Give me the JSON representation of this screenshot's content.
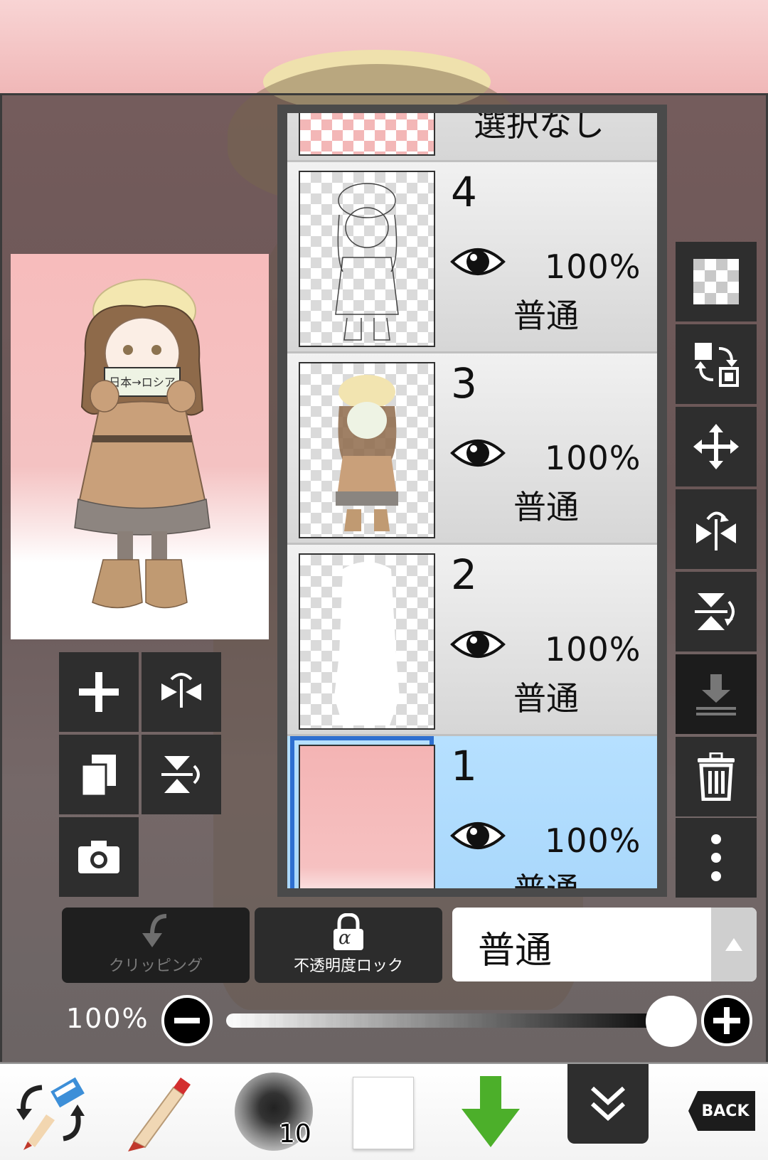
{
  "colors": {
    "panel_bg": "#2e2e2e",
    "selected_layer": "#a7d6fb",
    "selection_border": "#2e6fd0",
    "arrow_green": "#4caf2a"
  },
  "layer_panel": {
    "top_partial_label": "選択なし",
    "layers": [
      {
        "number": "4",
        "opacity": "100%",
        "blend": "普通",
        "visible": true,
        "selected": false
      },
      {
        "number": "3",
        "opacity": "100%",
        "blend": "普通",
        "visible": true,
        "selected": false
      },
      {
        "number": "2",
        "opacity": "100%",
        "blend": "普通",
        "visible": true,
        "selected": false
      },
      {
        "number": "1",
        "opacity": "100%",
        "blend": "普通",
        "visible": true,
        "selected": true
      }
    ]
  },
  "left_tools": [
    "add-layer-icon",
    "flip-horizontal-icon",
    "copy-layer-icon",
    "flip-vertical-icon",
    "camera-icon"
  ],
  "right_tools": [
    "transparent-fill-icon",
    "swap-layer-icon",
    "move-icon",
    "flip-horizontal-icon",
    "flip-vertical-icon",
    "merge-down-icon",
    "trash-icon",
    "more-vert-icon"
  ],
  "controls": {
    "clipping_label": "クリッピング",
    "opacity_lock_label": "不透明度ロック",
    "lock_symbol": "α",
    "blend_mode": "普通",
    "opacity_value": "100%",
    "opacity_fraction": 1.0
  },
  "toolbar": {
    "brush_size": "10",
    "back_label": "BACK",
    "preview_sign": "日本→ロシア"
  }
}
